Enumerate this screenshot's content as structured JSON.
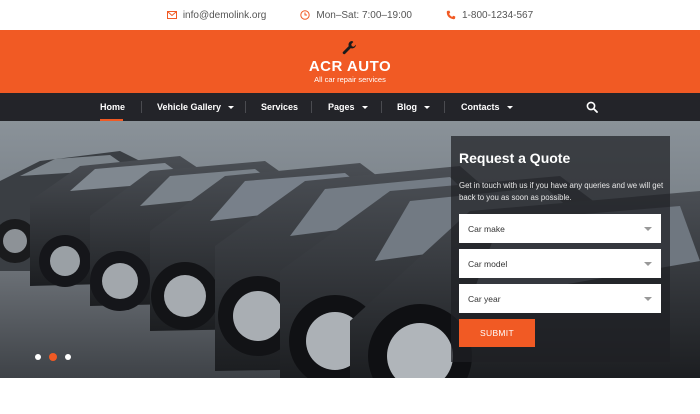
{
  "topbar": {
    "email": "info@demolink.org",
    "hours": "Mon–Sat: 7:00–19:00",
    "phone": "1-800-1234-567"
  },
  "brand": {
    "name": "ACR AUTO",
    "tagline": "All car repair services"
  },
  "nav": {
    "items": [
      {
        "label": "Home",
        "active": true
      },
      {
        "label": "Vehicle Gallery",
        "dropdown": true
      },
      {
        "label": "Services"
      },
      {
        "label": "Pages",
        "dropdown": true
      },
      {
        "label": "Blog",
        "dropdown": true
      },
      {
        "label": "Contacts",
        "dropdown": true
      }
    ]
  },
  "quote": {
    "title": "Request a Quote",
    "description": "Get in touch with us if you have any queries and we will get back to you as soon as possible.",
    "fields": [
      {
        "label": "Car make"
      },
      {
        "label": "Car model"
      },
      {
        "label": "Car year"
      }
    ],
    "submit_label": "SUBMIT"
  },
  "slider": {
    "active_slide": 2,
    "slide_count": 3
  },
  "colors": {
    "accent": "#f15a24",
    "nav_bg": "#232429"
  }
}
